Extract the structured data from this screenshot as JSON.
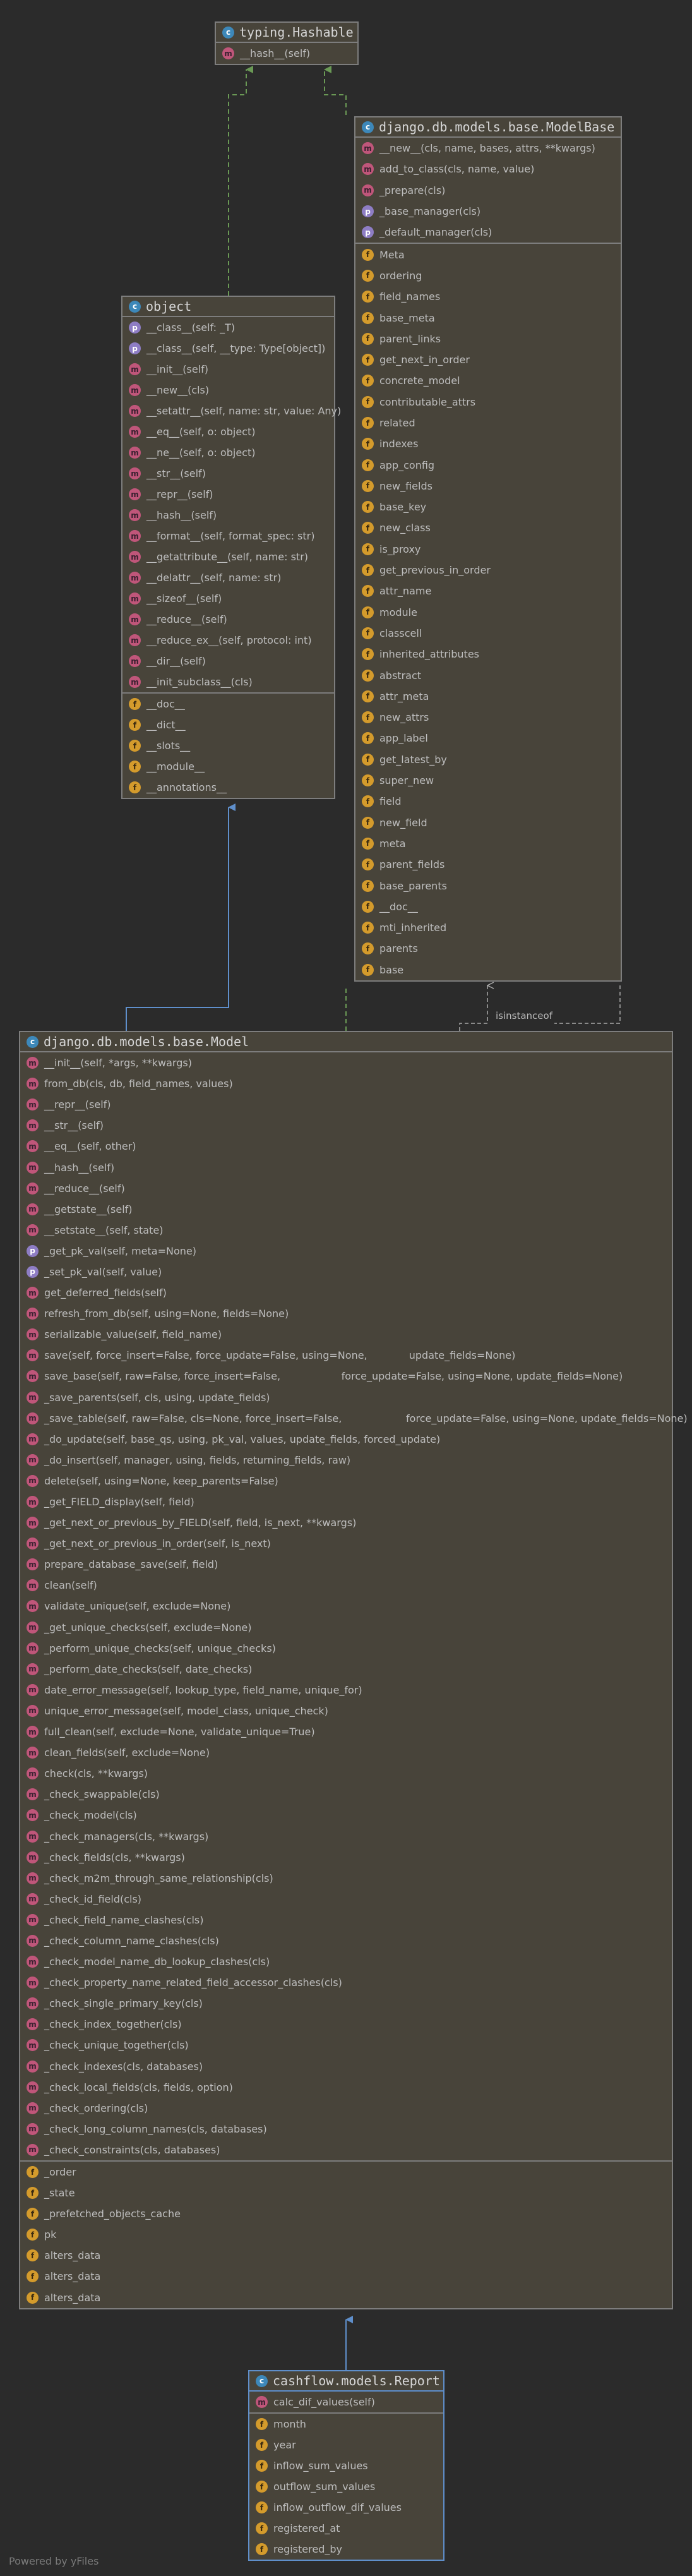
{
  "footer": "Powered by yFiles",
  "edge_label": "isinstanceof",
  "classes": [
    {
      "key": "hashable",
      "name": "typing.Hashable",
      "sections": [
        [
          {
            "kind": "m",
            "text": "__hash__(self)"
          }
        ]
      ]
    },
    {
      "key": "modelbase",
      "name": "django.db.models.base.ModelBase",
      "sections": [
        [
          {
            "kind": "m",
            "text": "__new__(cls, name, bases, attrs, **kwargs)"
          },
          {
            "kind": "m",
            "text": "add_to_class(cls, name, value)"
          },
          {
            "kind": "m",
            "text": "_prepare(cls)"
          },
          {
            "kind": "p",
            "text": "_base_manager(cls)"
          },
          {
            "kind": "p",
            "text": "_default_manager(cls)"
          }
        ],
        [
          {
            "kind": "f",
            "text": "Meta"
          },
          {
            "kind": "f",
            "text": "ordering"
          },
          {
            "kind": "f",
            "text": "field_names"
          },
          {
            "kind": "f",
            "text": "base_meta"
          },
          {
            "kind": "f",
            "text": "parent_links"
          },
          {
            "kind": "f",
            "text": "get_next_in_order"
          },
          {
            "kind": "f",
            "text": "concrete_model"
          },
          {
            "kind": "f",
            "text": "contributable_attrs"
          },
          {
            "kind": "f",
            "text": "related"
          },
          {
            "kind": "f",
            "text": "indexes"
          },
          {
            "kind": "f",
            "text": "app_config"
          },
          {
            "kind": "f",
            "text": "new_fields"
          },
          {
            "kind": "f",
            "text": "base_key"
          },
          {
            "kind": "f",
            "text": "new_class"
          },
          {
            "kind": "f",
            "text": "is_proxy"
          },
          {
            "kind": "f",
            "text": "get_previous_in_order"
          },
          {
            "kind": "f",
            "text": "attr_name"
          },
          {
            "kind": "f",
            "text": "module"
          },
          {
            "kind": "f",
            "text": "classcell"
          },
          {
            "kind": "f",
            "text": "inherited_attributes"
          },
          {
            "kind": "f",
            "text": "abstract"
          },
          {
            "kind": "f",
            "text": "attr_meta"
          },
          {
            "kind": "f",
            "text": "new_attrs"
          },
          {
            "kind": "f",
            "text": "app_label"
          },
          {
            "kind": "f",
            "text": "get_latest_by"
          },
          {
            "kind": "f",
            "text": "super_new"
          },
          {
            "kind": "f",
            "text": "field"
          },
          {
            "kind": "f",
            "text": "new_field"
          },
          {
            "kind": "f",
            "text": "meta"
          },
          {
            "kind": "f",
            "text": "parent_fields"
          },
          {
            "kind": "f",
            "text": "base_parents"
          },
          {
            "kind": "f",
            "text": "__doc__"
          },
          {
            "kind": "f",
            "text": "mti_inherited"
          },
          {
            "kind": "f",
            "text": "parents"
          },
          {
            "kind": "f",
            "text": "base"
          }
        ]
      ]
    },
    {
      "key": "object",
      "name": "object",
      "sections": [
        [
          {
            "kind": "p",
            "text": "__class__(self: _T)"
          },
          {
            "kind": "p",
            "text": "__class__(self, __type: Type[object])"
          },
          {
            "kind": "m",
            "text": "__init__(self)"
          },
          {
            "kind": "m",
            "text": "__new__(cls)"
          },
          {
            "kind": "m",
            "text": "__setattr__(self, name: str, value: Any)"
          },
          {
            "kind": "m",
            "text": "__eq__(self, o: object)"
          },
          {
            "kind": "m",
            "text": "__ne__(self, o: object)"
          },
          {
            "kind": "m",
            "text": "__str__(self)"
          },
          {
            "kind": "m",
            "text": "__repr__(self)"
          },
          {
            "kind": "m",
            "text": "__hash__(self)"
          },
          {
            "kind": "m",
            "text": "__format__(self, format_spec: str)"
          },
          {
            "kind": "m",
            "text": "__getattribute__(self, name: str)"
          },
          {
            "kind": "m",
            "text": "__delattr__(self, name: str)"
          },
          {
            "kind": "m",
            "text": "__sizeof__(self)"
          },
          {
            "kind": "m",
            "text": "__reduce__(self)"
          },
          {
            "kind": "m",
            "text": "__reduce_ex__(self, protocol: int)"
          },
          {
            "kind": "m",
            "text": "__dir__(self)"
          },
          {
            "kind": "m",
            "text": "__init_subclass__(cls)"
          }
        ],
        [
          {
            "kind": "f",
            "text": "__doc__"
          },
          {
            "kind": "f",
            "text": "__dict__"
          },
          {
            "kind": "f",
            "text": "__slots__"
          },
          {
            "kind": "f",
            "text": "__module__"
          },
          {
            "kind": "f",
            "text": "__annotations__"
          }
        ]
      ]
    },
    {
      "key": "model",
      "name": "django.db.models.base.Model",
      "sections": [
        [
          {
            "kind": "m",
            "text": "__init__(self, *args, **kwargs)"
          },
          {
            "kind": "m",
            "text": "from_db(cls, db, field_names, values)"
          },
          {
            "kind": "m",
            "text": "__repr__(self)"
          },
          {
            "kind": "m",
            "text": "__str__(self)"
          },
          {
            "kind": "m",
            "text": "__eq__(self, other)"
          },
          {
            "kind": "m",
            "text": "__hash__(self)"
          },
          {
            "kind": "m",
            "text": "__reduce__(self)"
          },
          {
            "kind": "m",
            "text": "__getstate__(self)"
          },
          {
            "kind": "m",
            "text": "__setstate__(self, state)"
          },
          {
            "kind": "p",
            "text": "_get_pk_val(self, meta=None)"
          },
          {
            "kind": "p",
            "text": "_set_pk_val(self, value)"
          },
          {
            "kind": "m",
            "text": "get_deferred_fields(self)"
          },
          {
            "kind": "m",
            "text": "refresh_from_db(self, using=None, fields=None)"
          },
          {
            "kind": "m",
            "text": "serializable_value(self, field_name)"
          },
          {
            "kind": "m",
            "text": "save(self, force_insert=False, force_update=False, using=None,             update_fields=None)"
          },
          {
            "kind": "m",
            "text": "save_base(self, raw=False, force_insert=False,                   force_update=False, using=None, update_fields=None)"
          },
          {
            "kind": "m",
            "text": "_save_parents(self, cls, using, update_fields)"
          },
          {
            "kind": "m",
            "text": "_save_table(self, raw=False, cls=None, force_insert=False,                    force_update=False, using=None, update_fields=None)"
          },
          {
            "kind": "m",
            "text": "_do_update(self, base_qs, using, pk_val, values, update_fields, forced_update)"
          },
          {
            "kind": "m",
            "text": "_do_insert(self, manager, using, fields, returning_fields, raw)"
          },
          {
            "kind": "m",
            "text": "delete(self, using=None, keep_parents=False)"
          },
          {
            "kind": "m",
            "text": "_get_FIELD_display(self, field)"
          },
          {
            "kind": "m",
            "text": "_get_next_or_previous_by_FIELD(self, field, is_next, **kwargs)"
          },
          {
            "kind": "m",
            "text": "_get_next_or_previous_in_order(self, is_next)"
          },
          {
            "kind": "m",
            "text": "prepare_database_save(self, field)"
          },
          {
            "kind": "m",
            "text": "clean(self)"
          },
          {
            "kind": "m",
            "text": "validate_unique(self, exclude=None)"
          },
          {
            "kind": "m",
            "text": "_get_unique_checks(self, exclude=None)"
          },
          {
            "kind": "m",
            "text": "_perform_unique_checks(self, unique_checks)"
          },
          {
            "kind": "m",
            "text": "_perform_date_checks(self, date_checks)"
          },
          {
            "kind": "m",
            "text": "date_error_message(self, lookup_type, field_name, unique_for)"
          },
          {
            "kind": "m",
            "text": "unique_error_message(self, model_class, unique_check)"
          },
          {
            "kind": "m",
            "text": "full_clean(self, exclude=None, validate_unique=True)"
          },
          {
            "kind": "m",
            "text": "clean_fields(self, exclude=None)"
          },
          {
            "kind": "m",
            "text": "check(cls, **kwargs)"
          },
          {
            "kind": "m",
            "text": "_check_swappable(cls)"
          },
          {
            "kind": "m",
            "text": "_check_model(cls)"
          },
          {
            "kind": "m",
            "text": "_check_managers(cls, **kwargs)"
          },
          {
            "kind": "m",
            "text": "_check_fields(cls, **kwargs)"
          },
          {
            "kind": "m",
            "text": "_check_m2m_through_same_relationship(cls)"
          },
          {
            "kind": "m",
            "text": "_check_id_field(cls)"
          },
          {
            "kind": "m",
            "text": "_check_field_name_clashes(cls)"
          },
          {
            "kind": "m",
            "text": "_check_column_name_clashes(cls)"
          },
          {
            "kind": "m",
            "text": "_check_model_name_db_lookup_clashes(cls)"
          },
          {
            "kind": "m",
            "text": "_check_property_name_related_field_accessor_clashes(cls)"
          },
          {
            "kind": "m",
            "text": "_check_single_primary_key(cls)"
          },
          {
            "kind": "m",
            "text": "_check_index_together(cls)"
          },
          {
            "kind": "m",
            "text": "_check_unique_together(cls)"
          },
          {
            "kind": "m",
            "text": "_check_indexes(cls, databases)"
          },
          {
            "kind": "m",
            "text": "_check_local_fields(cls, fields, option)"
          },
          {
            "kind": "m",
            "text": "_check_ordering(cls)"
          },
          {
            "kind": "m",
            "text": "_check_long_column_names(cls, databases)"
          },
          {
            "kind": "m",
            "text": "_check_constraints(cls, databases)"
          }
        ],
        [
          {
            "kind": "f",
            "text": "_order"
          },
          {
            "kind": "f",
            "text": "_state"
          },
          {
            "kind": "f",
            "text": "_prefetched_objects_cache"
          },
          {
            "kind": "f",
            "text": "pk"
          },
          {
            "kind": "f",
            "text": "alters_data"
          },
          {
            "kind": "f",
            "text": "alters_data"
          },
          {
            "kind": "f",
            "text": "alters_data"
          }
        ]
      ]
    },
    {
      "key": "report",
      "name": "cashflow.models.Report",
      "sections": [
        [
          {
            "kind": "m",
            "text": "calc_dif_values(self)"
          }
        ],
        [
          {
            "kind": "f",
            "text": "month"
          },
          {
            "kind": "f",
            "text": "year"
          },
          {
            "kind": "f",
            "text": "inflow_sum_values"
          },
          {
            "kind": "f",
            "text": "outflow_sum_values"
          },
          {
            "kind": "f",
            "text": "inflow_outflow_dif_values"
          },
          {
            "kind": "f",
            "text": "registered_at"
          },
          {
            "kind": "f",
            "text": "registered_by"
          }
        ]
      ]
    }
  ]
}
